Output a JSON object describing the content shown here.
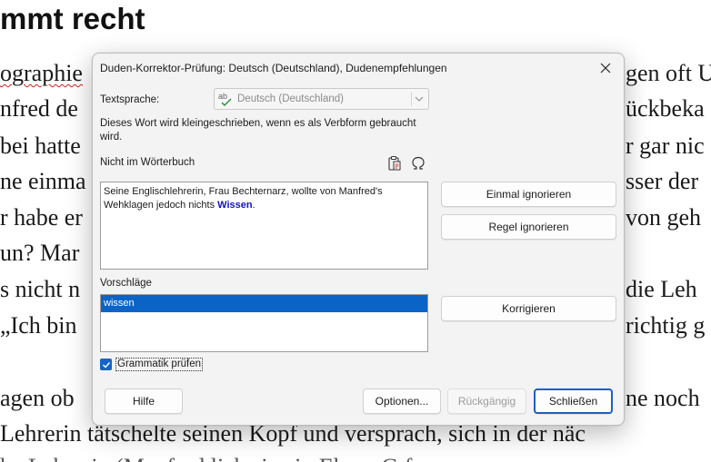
{
  "document": {
    "heading": "mmt recht",
    "lines": [
      "ographie",
      "nfred de",
      "bei hatte",
      "ne einma",
      "r habe er",
      "un? Mar",
      "s nicht n",
      "„Ich bin",
      "agen ob",
      " Lehrerin tätschelte seinen Kopf und versprach, sich in der näc",
      " he   Lehrerin  (Manfred  lieb  sie ein  Ehren  G  f"
    ],
    "right_lines": [
      "gen oft U",
      "ückbeka",
      "r gar nic",
      "sser der",
      "von geh",
      "",
      "die Leh",
      "richtig g",
      "ne noch"
    ]
  },
  "dialog": {
    "title": "Duden-Korrektor-Prüfung: Deutsch (Deutschland), Dudenempfehlungen",
    "language_label": "Textsprache:",
    "language_value": "Deutsch (Deutschland)",
    "hint": "Dieses Wort wird kleingeschrieben, wenn es als Verbform gebraucht wird.",
    "section_label": "Nicht im Wörterbuch",
    "sentence_before": "Seine Englischlehrerin, Frau Bechternarz, wollte von Manfred's Wehklagen jedoch nichts ",
    "error_word": "Wissen",
    "sentence_after": ".",
    "suggestions_label": "Vorschläge",
    "suggestions": [
      "wissen"
    ],
    "grammar_check_label": "Grammatik prüfen",
    "grammar_checked": true,
    "buttons": {
      "ignore_once": "Einmal ignorieren",
      "ignore_rule": "Regel ignorieren",
      "correct": "Korrigieren",
      "help": "Hilfe",
      "options": "Optionen...",
      "undo": "Rückgängig",
      "close": "Schließen"
    }
  },
  "colors": {
    "accent": "#0a64c8",
    "error_text": "#1212c8"
  }
}
